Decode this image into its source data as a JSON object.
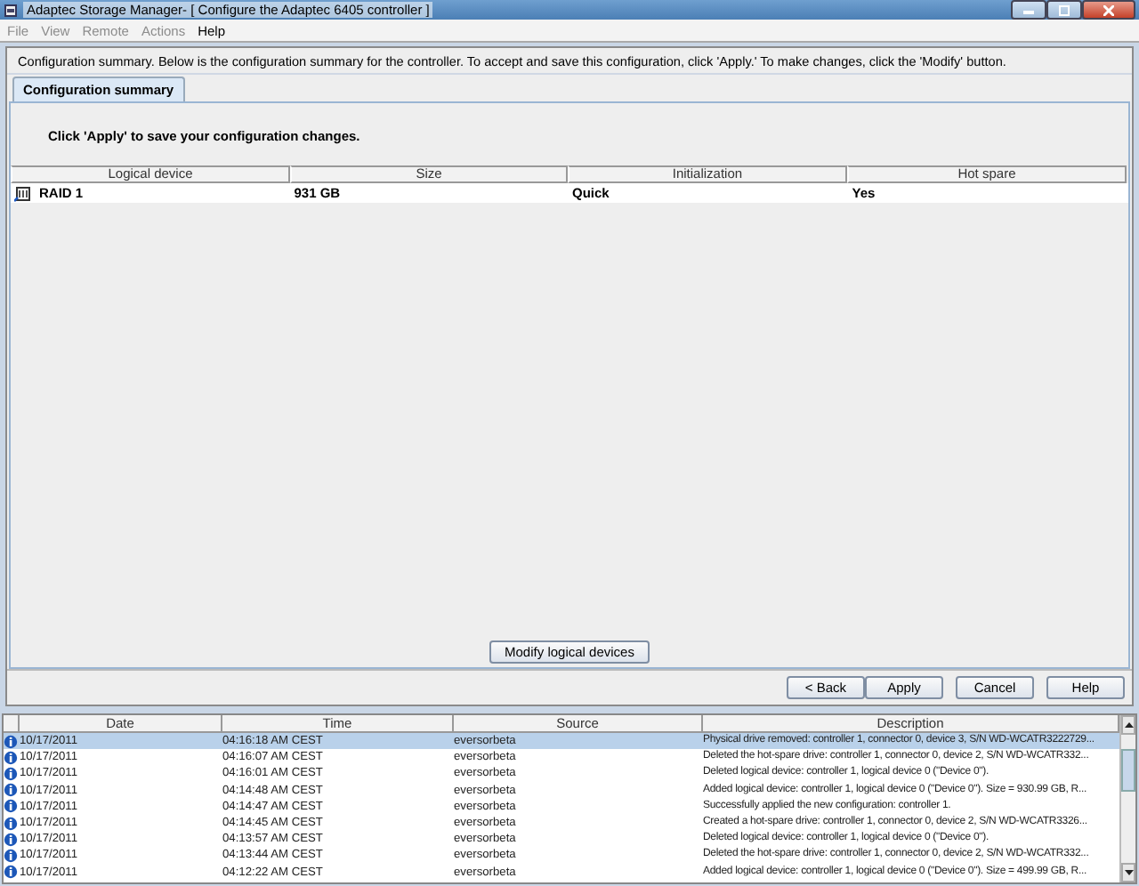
{
  "window": {
    "title": "Adaptec Storage Manager- [ Configure the Adaptec 6405 controller ]"
  },
  "menu": [
    {
      "label": "File",
      "disabled": true
    },
    {
      "label": "View",
      "disabled": true
    },
    {
      "label": "Remote",
      "disabled": true
    },
    {
      "label": "Actions",
      "disabled": true
    },
    {
      "label": "Help",
      "disabled": false
    }
  ],
  "instructions": "Configuration summary. Below is the configuration summary for the controller.  To accept and save this configuration, click 'Apply.'  To make changes, click the 'Modify' button.",
  "tabs": [
    {
      "label": "Configuration summary",
      "selected": true
    }
  ],
  "prompt": "Click 'Apply' to save your configuration changes.",
  "table": {
    "columns": [
      "Logical device",
      "Size",
      "Initialization",
      "Hot spare"
    ],
    "rows": [
      [
        "RAID 1",
        "931 GB",
        "Quick",
        "Yes"
      ]
    ]
  },
  "modify_button": "Modify logical devices",
  "buttons": [
    "< Back",
    "Apply",
    "Cancel",
    "Help"
  ],
  "event_log": {
    "columns": [
      "Date",
      "Time",
      "Source",
      "Description"
    ],
    "rows": [
      {
        "date": "10/17/2011",
        "time": "04:16:18 AM CEST",
        "source": "eversorbeta",
        "description": "Physical drive removed: controller 1, connector 0, device 3, S/N WD-WCATR3222729...",
        "selected": true
      },
      {
        "date": "10/17/2011",
        "time": "04:16:07 AM CEST",
        "source": "eversorbeta",
        "description": "Deleted the hot-spare drive: controller 1, connector 0, device 2, S/N WD-WCATR332...",
        "selected": false
      },
      {
        "date": "10/17/2011",
        "time": "04:16:01 AM CEST",
        "source": "eversorbeta",
        "description": "Deleted logical device: controller 1, logical device 0 (\"Device 0\").",
        "selected": false
      },
      {
        "date": "10/17/2011",
        "time": "04:14:48 AM CEST",
        "source": "eversorbeta",
        "description": "Added logical device: controller 1, logical device 0 (\"Device 0\"). Size = 930.99 GB, R...",
        "selected": false
      },
      {
        "date": "10/17/2011",
        "time": "04:14:47 AM CEST",
        "source": "eversorbeta",
        "description": "Successfully applied the new configuration: controller 1.",
        "selected": false
      },
      {
        "date": "10/17/2011",
        "time": "04:14:45 AM CEST",
        "source": "eversorbeta",
        "description": "Created a hot-spare drive: controller 1, connector 0, device 2, S/N WD-WCATR3326...",
        "selected": false
      },
      {
        "date": "10/17/2011",
        "time": "04:13:57 AM CEST",
        "source": "eversorbeta",
        "description": "Deleted logical device: controller 1, logical device 0 (\"Device 0\").",
        "selected": false
      },
      {
        "date": "10/17/2011",
        "time": "04:13:44 AM CEST",
        "source": "eversorbeta",
        "description": "Deleted the hot-spare drive: controller 1, connector 0, device 2, S/N WD-WCATR332...",
        "selected": false
      },
      {
        "date": "10/17/2011",
        "time": "04:12:22 AM CEST",
        "source": "eversorbeta",
        "description": "Added logical device: controller 1, logical device 0 (\"Device 0\"). Size = 499.99 GB, R...",
        "selected": false
      }
    ]
  }
}
